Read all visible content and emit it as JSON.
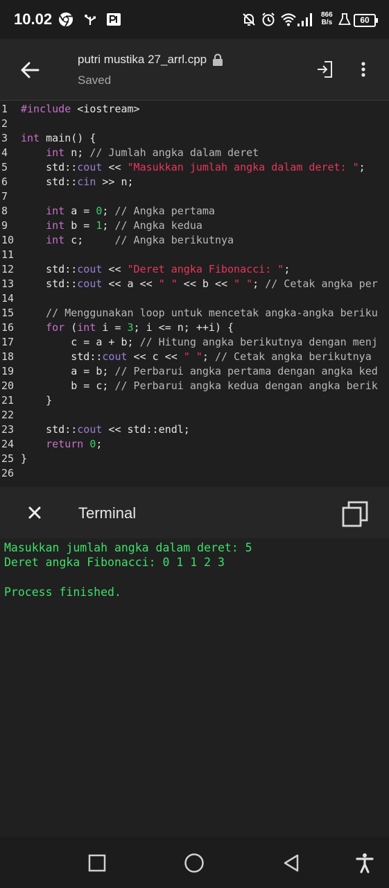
{
  "status_bar": {
    "time": "10.02",
    "net_speed_value": "866",
    "net_speed_unit": "B/s",
    "battery": "60",
    "icons": [
      "chrome-icon",
      "usb-icon",
      "parking-icon",
      "bell-off-icon",
      "alarm-icon",
      "wifi-icon",
      "signal-icon",
      "flask-icon",
      "battery-icon"
    ]
  },
  "app_bar": {
    "file_name": "putri mustika 27_arrl.cpp",
    "save_status": "Saved",
    "icons": [
      "back-arrow-icon",
      "lock-icon",
      "run-icon",
      "more-vert-icon"
    ]
  },
  "editor": {
    "lines": [
      {
        "n": "1",
        "tokens": [
          {
            "t": "#include",
            "c": "kw"
          },
          {
            "t": " <iostream>",
            "c": ""
          }
        ]
      },
      {
        "n": "2",
        "tokens": []
      },
      {
        "n": "3",
        "tokens": [
          {
            "t": "int",
            "c": "kw"
          },
          {
            "t": " main() {",
            "c": ""
          }
        ]
      },
      {
        "n": "4",
        "tokens": [
          {
            "t": "    ",
            "c": ""
          },
          {
            "t": "int",
            "c": "kw"
          },
          {
            "t": " n; ",
            "c": ""
          },
          {
            "t": "// Jumlah angka dalam deret",
            "c": "cm"
          }
        ]
      },
      {
        "n": "5",
        "tokens": [
          {
            "t": "    std::",
            "c": ""
          },
          {
            "t": "cout",
            "c": "ns"
          },
          {
            "t": " << ",
            "c": ""
          },
          {
            "t": "\"Masukkan jumlah angka dalam deret: \"",
            "c": "str"
          },
          {
            "t": ";",
            "c": ""
          }
        ]
      },
      {
        "n": "6",
        "tokens": [
          {
            "t": "    std::",
            "c": ""
          },
          {
            "t": "cin",
            "c": "ns"
          },
          {
            "t": " >> n;",
            "c": ""
          }
        ]
      },
      {
        "n": "7",
        "tokens": []
      },
      {
        "n": "8",
        "tokens": [
          {
            "t": "    ",
            "c": ""
          },
          {
            "t": "int",
            "c": "kw"
          },
          {
            "t": " a = ",
            "c": ""
          },
          {
            "t": "0",
            "c": "num"
          },
          {
            "t": "; ",
            "c": ""
          },
          {
            "t": "// Angka pertama",
            "c": "cm"
          }
        ]
      },
      {
        "n": "9",
        "tokens": [
          {
            "t": "    ",
            "c": ""
          },
          {
            "t": "int",
            "c": "kw"
          },
          {
            "t": " b = ",
            "c": ""
          },
          {
            "t": "1",
            "c": "num"
          },
          {
            "t": "; ",
            "c": ""
          },
          {
            "t": "// Angka kedua",
            "c": "cm"
          }
        ]
      },
      {
        "n": "10",
        "tokens": [
          {
            "t": "    ",
            "c": ""
          },
          {
            "t": "int",
            "c": "kw"
          },
          {
            "t": " c;     ",
            "c": ""
          },
          {
            "t": "// Angka berikutnya",
            "c": "cm"
          }
        ]
      },
      {
        "n": "11",
        "tokens": []
      },
      {
        "n": "12",
        "tokens": [
          {
            "t": "    std::",
            "c": ""
          },
          {
            "t": "cout",
            "c": "ns"
          },
          {
            "t": " << ",
            "c": ""
          },
          {
            "t": "\"Deret angka Fibonacci: \"",
            "c": "str"
          },
          {
            "t": ";",
            "c": ""
          }
        ]
      },
      {
        "n": "13",
        "tokens": [
          {
            "t": "    std::",
            "c": ""
          },
          {
            "t": "cout",
            "c": "ns"
          },
          {
            "t": " << a << ",
            "c": ""
          },
          {
            "t": "\" \"",
            "c": "str"
          },
          {
            "t": " << b << ",
            "c": ""
          },
          {
            "t": "\" \"",
            "c": "str"
          },
          {
            "t": "; ",
            "c": ""
          },
          {
            "t": "// Cetak angka per",
            "c": "cm"
          }
        ]
      },
      {
        "n": "14",
        "tokens": []
      },
      {
        "n": "15",
        "tokens": [
          {
            "t": "    ",
            "c": ""
          },
          {
            "t": "// Menggunakan loop untuk mencetak angka-angka beriku",
            "c": "cm"
          }
        ]
      },
      {
        "n": "16",
        "tokens": [
          {
            "t": "    ",
            "c": ""
          },
          {
            "t": "for",
            "c": "kw"
          },
          {
            "t": " (",
            "c": ""
          },
          {
            "t": "int",
            "c": "kw"
          },
          {
            "t": " i = ",
            "c": ""
          },
          {
            "t": "3",
            "c": "num"
          },
          {
            "t": "; i <= n; ++i) {",
            "c": ""
          }
        ]
      },
      {
        "n": "17",
        "tokens": [
          {
            "t": "        c = a + b; ",
            "c": ""
          },
          {
            "t": "// Hitung angka berikutnya dengan menj",
            "c": "cm"
          }
        ]
      },
      {
        "n": "18",
        "tokens": [
          {
            "t": "        std::",
            "c": ""
          },
          {
            "t": "cout",
            "c": "ns"
          },
          {
            "t": " << c << ",
            "c": ""
          },
          {
            "t": "\" \"",
            "c": "str"
          },
          {
            "t": "; ",
            "c": ""
          },
          {
            "t": "// Cetak angka berikutnya",
            "c": "cm"
          }
        ]
      },
      {
        "n": "19",
        "tokens": [
          {
            "t": "        a = b; ",
            "c": ""
          },
          {
            "t": "// Perbarui angka pertama dengan angka ked",
            "c": "cm"
          }
        ]
      },
      {
        "n": "20",
        "tokens": [
          {
            "t": "        b = c; ",
            "c": ""
          },
          {
            "t": "// Perbarui angka kedua dengan angka berik",
            "c": "cm"
          }
        ]
      },
      {
        "n": "21",
        "tokens": [
          {
            "t": "    }",
            "c": ""
          }
        ]
      },
      {
        "n": "22",
        "tokens": []
      },
      {
        "n": "23",
        "tokens": [
          {
            "t": "    std::",
            "c": ""
          },
          {
            "t": "cout",
            "c": "ns"
          },
          {
            "t": " << std::endl;",
            "c": ""
          }
        ]
      },
      {
        "n": "24",
        "tokens": [
          {
            "t": "    ",
            "c": ""
          },
          {
            "t": "return",
            "c": "kw"
          },
          {
            "t": " ",
            "c": ""
          },
          {
            "t": "0",
            "c": "num"
          },
          {
            "t": ";",
            "c": ""
          }
        ]
      },
      {
        "n": "25",
        "tokens": [
          {
            "t": "}",
            "c": ""
          }
        ]
      },
      {
        "n": "26",
        "tokens": []
      }
    ]
  },
  "terminal": {
    "title": "Terminal",
    "output": [
      "Masukkan jumlah angka dalam deret: 5",
      "Deret angka Fibonacci: 0 1 1 2 3",
      "",
      "Process finished."
    ],
    "icons": [
      "close-icon",
      "copy-icon"
    ]
  },
  "nav_bar": {
    "icons": [
      "recents-icon",
      "home-icon",
      "back-icon",
      "accessibility-icon"
    ]
  },
  "colors": {
    "keyword": "#c671c8",
    "string": "#e8365a",
    "comment": "#b8b8b8",
    "number": "#3ccf6b",
    "namespace_member": "#9b7fd8",
    "terminal_text": "#3de06b",
    "background": "#202020"
  }
}
